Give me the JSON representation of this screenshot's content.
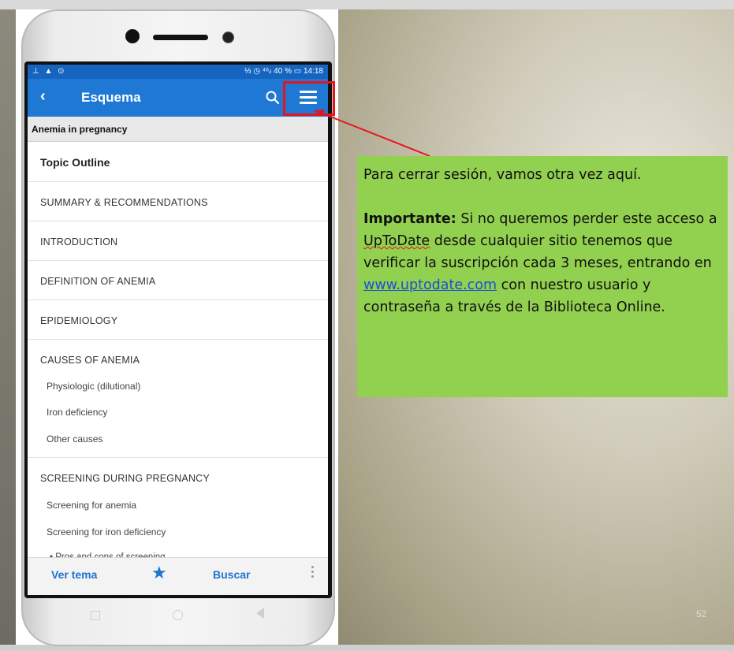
{
  "status_bar": {
    "left_icons": "⊥ ▲ ⊙",
    "right_text": "⅓ ◷ ⁴⁶ᵢₗ 40 % ▭ 14:18"
  },
  "app_bar": {
    "title": "Esquema"
  },
  "breadcrumb": "Anemia in pregnancy",
  "outline": {
    "title": "Topic Outline",
    "sections": [
      {
        "label": "SUMMARY & RECOMMENDATIONS"
      },
      {
        "label": "INTRODUCTION"
      },
      {
        "label": "DEFINITION OF ANEMIA"
      },
      {
        "label": "EPIDEMIOLOGY"
      },
      {
        "label": "CAUSES OF ANEMIA",
        "subs": [
          "Physiologic (dilutional)",
          "Iron deficiency",
          "Other causes"
        ]
      },
      {
        "label": "SCREENING DURING PREGNANCY",
        "subs": [
          "Screening for anemia",
          "Screening for iron deficiency",
          "• Pros and cons of screening"
        ]
      }
    ]
  },
  "bottom_bar": {
    "view_label": "Ver tema",
    "search_label": "Buscar"
  },
  "callout": {
    "line1": "Para cerrar sesión, vamos otra vez aquí.",
    "bold": "Importante:",
    "text_a": " Si no queremos perder este acceso a ",
    "brand": "UpToDate",
    "text_b": " desde cualquier sitio tenemos que verificar la suscripción cada 3 meses, entrando en ",
    "link": "www.uptodate.com",
    "text_c": " con nuestro usuario y contraseña a través de la Biblioteca Online."
  },
  "slide_number": "52",
  "colors": {
    "app_bar": "#1e78d4",
    "status_bar": "#1565c0",
    "accent_blue": "#1e73cf",
    "callout_green": "#92d050",
    "highlight_red": "#e8141c"
  }
}
